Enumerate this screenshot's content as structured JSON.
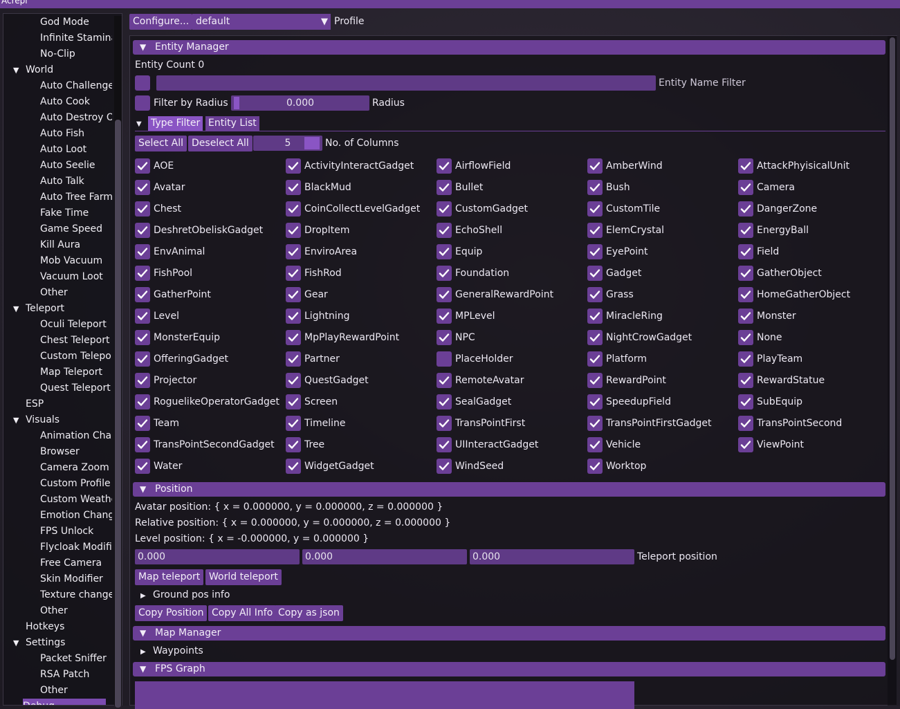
{
  "window": {
    "title": "Acrepi"
  },
  "sidebar": {
    "items": [
      {
        "label": "God Mode",
        "kind": "child"
      },
      {
        "label": "Infinite Stamina",
        "kind": "child"
      },
      {
        "label": "No-Clip",
        "kind": "child"
      },
      {
        "label": "World",
        "kind": "parent"
      },
      {
        "label": "Auto Challenge",
        "kind": "child"
      },
      {
        "label": "Auto Cook",
        "kind": "child"
      },
      {
        "label": "Auto Destroy Ob",
        "kind": "child"
      },
      {
        "label": "Auto Fish",
        "kind": "child"
      },
      {
        "label": "Auto Loot",
        "kind": "child"
      },
      {
        "label": "Auto Seelie",
        "kind": "child"
      },
      {
        "label": "Auto Talk",
        "kind": "child"
      },
      {
        "label": "Auto Tree Farm",
        "kind": "child"
      },
      {
        "label": "Fake Time",
        "kind": "child"
      },
      {
        "label": "Game Speed",
        "kind": "child"
      },
      {
        "label": "Kill Aura",
        "kind": "child"
      },
      {
        "label": "Mob Vacuum",
        "kind": "child"
      },
      {
        "label": "Vacuum Loot",
        "kind": "child"
      },
      {
        "label": "Other",
        "kind": "child"
      },
      {
        "label": "Teleport",
        "kind": "parent"
      },
      {
        "label": "Oculi Teleport",
        "kind": "child"
      },
      {
        "label": "Chest Teleport",
        "kind": "child"
      },
      {
        "label": "Custom Telepor",
        "kind": "child"
      },
      {
        "label": "Map Teleport",
        "kind": "child"
      },
      {
        "label": "Quest Teleport",
        "kind": "child"
      },
      {
        "label": "ESP",
        "kind": "plain"
      },
      {
        "label": "Visuals",
        "kind": "parent"
      },
      {
        "label": "Animation Chan",
        "kind": "child"
      },
      {
        "label": "Browser",
        "kind": "child"
      },
      {
        "label": "Camera Zoom",
        "kind": "child"
      },
      {
        "label": "Custom Profile",
        "kind": "child"
      },
      {
        "label": "Custom Weathe",
        "kind": "child"
      },
      {
        "label": "Emotion Change",
        "kind": "child"
      },
      {
        "label": "FPS Unlock",
        "kind": "child"
      },
      {
        "label": "Flycloak Modifie",
        "kind": "child"
      },
      {
        "label": "Free Camera",
        "kind": "child"
      },
      {
        "label": "Skin Modifier",
        "kind": "child"
      },
      {
        "label": "Texture change",
        "kind": "child"
      },
      {
        "label": "Other",
        "kind": "child"
      },
      {
        "label": "Hotkeys",
        "kind": "plain"
      },
      {
        "label": "Settings",
        "kind": "parent"
      },
      {
        "label": "Packet Sniffer",
        "kind": "child"
      },
      {
        "label": "RSA Patch",
        "kind": "child"
      },
      {
        "label": "Other",
        "kind": "child"
      },
      {
        "label": "Debug",
        "kind": "plain-sel"
      }
    ]
  },
  "toolbar": {
    "configure": "Configure...",
    "profile_value": "default",
    "profile_label": "Profile"
  },
  "entity_manager": {
    "header": "Entity Manager",
    "count_label": "Entity Count 0",
    "name_filter_label": "Entity Name Filter",
    "filter_radius_label": "Filter by Radius",
    "radius_value": "0.000",
    "radius_label": "Radius",
    "tabs": [
      "Type Filter",
      "Entity List"
    ],
    "select_all": "Select All",
    "deselect_all": "Deselect All",
    "columns_value": "5",
    "columns_label": "No. of Columns",
    "types": [
      {
        "n": "AOE",
        "c": true
      },
      {
        "n": "ActivityInteractGadget",
        "c": true
      },
      {
        "n": "AirflowField",
        "c": true
      },
      {
        "n": "AmberWind",
        "c": true
      },
      {
        "n": "AttackPhyisicalUnit",
        "c": true
      },
      {
        "n": "Avatar",
        "c": true
      },
      {
        "n": "BlackMud",
        "c": true
      },
      {
        "n": "Bullet",
        "c": true
      },
      {
        "n": "Bush",
        "c": true
      },
      {
        "n": "Camera",
        "c": true
      },
      {
        "n": "Chest",
        "c": true
      },
      {
        "n": "CoinCollectLevelGadget",
        "c": true
      },
      {
        "n": "CustomGadget",
        "c": true
      },
      {
        "n": "CustomTile",
        "c": true
      },
      {
        "n": "DangerZone",
        "c": true
      },
      {
        "n": "DeshretObeliskGadget",
        "c": true
      },
      {
        "n": "DropItem",
        "c": true
      },
      {
        "n": "EchoShell",
        "c": true
      },
      {
        "n": "ElemCrystal",
        "c": true
      },
      {
        "n": "EnergyBall",
        "c": true
      },
      {
        "n": "EnvAnimal",
        "c": true
      },
      {
        "n": "EnviroArea",
        "c": true
      },
      {
        "n": "Equip",
        "c": true
      },
      {
        "n": "EyePoint",
        "c": true
      },
      {
        "n": "Field",
        "c": true
      },
      {
        "n": "FishPool",
        "c": true
      },
      {
        "n": "FishRod",
        "c": true
      },
      {
        "n": "Foundation",
        "c": true
      },
      {
        "n": "Gadget",
        "c": true
      },
      {
        "n": "GatherObject",
        "c": true
      },
      {
        "n": "GatherPoint",
        "c": true
      },
      {
        "n": "Gear",
        "c": true
      },
      {
        "n": "GeneralRewardPoint",
        "c": true
      },
      {
        "n": "Grass",
        "c": true
      },
      {
        "n": "HomeGatherObject",
        "c": true
      },
      {
        "n": "Level",
        "c": true
      },
      {
        "n": "Lightning",
        "c": true
      },
      {
        "n": "MPLevel",
        "c": true
      },
      {
        "n": "MiracleRing",
        "c": true
      },
      {
        "n": "Monster",
        "c": true
      },
      {
        "n": "MonsterEquip",
        "c": true
      },
      {
        "n": "MpPlayRewardPoint",
        "c": true
      },
      {
        "n": "NPC",
        "c": true
      },
      {
        "n": "NightCrowGadget",
        "c": true
      },
      {
        "n": "None",
        "c": true
      },
      {
        "n": "OfferingGadget",
        "c": true
      },
      {
        "n": "Partner",
        "c": true
      },
      {
        "n": "PlaceHolder",
        "c": false
      },
      {
        "n": "Platform",
        "c": true
      },
      {
        "n": "PlayTeam",
        "c": true
      },
      {
        "n": "Projector",
        "c": true
      },
      {
        "n": "QuestGadget",
        "c": true
      },
      {
        "n": "RemoteAvatar",
        "c": true
      },
      {
        "n": "RewardPoint",
        "c": true
      },
      {
        "n": "RewardStatue",
        "c": true
      },
      {
        "n": "RoguelikeOperatorGadget",
        "c": true
      },
      {
        "n": "Screen",
        "c": true
      },
      {
        "n": "SealGadget",
        "c": true
      },
      {
        "n": "SpeedupField",
        "c": true
      },
      {
        "n": "SubEquip",
        "c": true
      },
      {
        "n": "Team",
        "c": true
      },
      {
        "n": "Timeline",
        "c": true
      },
      {
        "n": "TransPointFirst",
        "c": true
      },
      {
        "n": "TransPointFirstGadget",
        "c": true
      },
      {
        "n": "TransPointSecond",
        "c": true
      },
      {
        "n": "TransPointSecondGadget",
        "c": true
      },
      {
        "n": "Tree",
        "c": true
      },
      {
        "n": "UIInteractGadget",
        "c": true
      },
      {
        "n": "Vehicle",
        "c": true
      },
      {
        "n": "ViewPoint",
        "c": true
      },
      {
        "n": "Water",
        "c": true
      },
      {
        "n": "WidgetGadget",
        "c": true
      },
      {
        "n": "WindSeed",
        "c": true
      },
      {
        "n": "Worktop",
        "c": true
      }
    ]
  },
  "position": {
    "header": "Position",
    "avatar": "Avatar position: { x = 0.000000, y = 0.000000, z = 0.000000 }",
    "relative": "Relative position: { x = 0.000000, y = 0.000000, z = 0.000000 }",
    "level": "Level position: { x = -0.000000, y = 0.000000 }",
    "x": "0.000",
    "y": "0.000",
    "z": "0.000",
    "teleport_label": "Teleport position",
    "map_teleport": "Map teleport",
    "world_teleport": "World teleport",
    "ground_pos": "Ground pos info",
    "copy_position": "Copy Position",
    "copy_all": "Copy All Info",
    "copy_json": "Copy as json"
  },
  "map_manager": {
    "header": "Map Manager",
    "waypoints": "Waypoints"
  },
  "fps_graph": {
    "header": "FPS Graph"
  },
  "colors": {
    "accent": "#6b3f96",
    "accent_active": "#8a55c4"
  }
}
